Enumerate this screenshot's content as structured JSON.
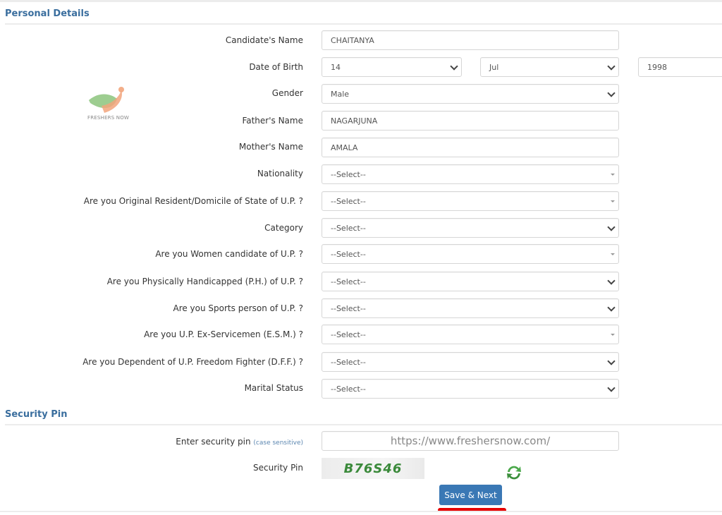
{
  "sections": {
    "personal_details": "Personal Details",
    "security_pin": "Security Pin"
  },
  "logo": {
    "text": "FRESHERS NOW"
  },
  "personal": {
    "candidate_name": {
      "label": "Candidate's Name",
      "value": "CHAITANYA"
    },
    "dob": {
      "label": "Date of Birth",
      "day": "14",
      "month": "Jul",
      "year": "1998"
    },
    "gender": {
      "label": "Gender",
      "value": "Male"
    },
    "father_name": {
      "label": "Father's Name",
      "value": "NAGARJUNA"
    },
    "mother_name": {
      "label": "Mother's Name",
      "value": "AMALA"
    },
    "nationality": {
      "label": "Nationality",
      "value": "--Select--"
    },
    "domicile": {
      "label": "Are you Original Resident/Domicile of State of U.P. ?",
      "value": "--Select--"
    },
    "category": {
      "label": "Category",
      "value": "--Select--"
    },
    "women": {
      "label": "Are you Women candidate of U.P. ?",
      "value": "--Select--"
    },
    "ph": {
      "label": "Are you Physically Handicapped (P.H.) of U.P. ?",
      "value": "--Select--"
    },
    "sports": {
      "label": "Are you Sports person of U.P. ?",
      "value": "--Select--"
    },
    "esm": {
      "label": "Are you U.P. Ex-Servicemen (E.S.M.) ?",
      "value": "--Select--"
    },
    "dff": {
      "label": "Are you Dependent of U.P. Freedom Fighter (D.F.F.) ?",
      "value": "--Select--"
    },
    "marital": {
      "label": "Marital Status",
      "value": "--Select--"
    }
  },
  "security": {
    "enter_label": "Enter security pin",
    "enter_hint": "(case sensitive)",
    "enter_value": "https://www.freshersnow.com/",
    "pin_label": "Security Pin",
    "captcha_text": "B76S46",
    "save_button": "Save & Next"
  },
  "colors": {
    "accent": "#3a78b5",
    "section_title": "#3a6e9e",
    "highlight": "#e60000"
  }
}
